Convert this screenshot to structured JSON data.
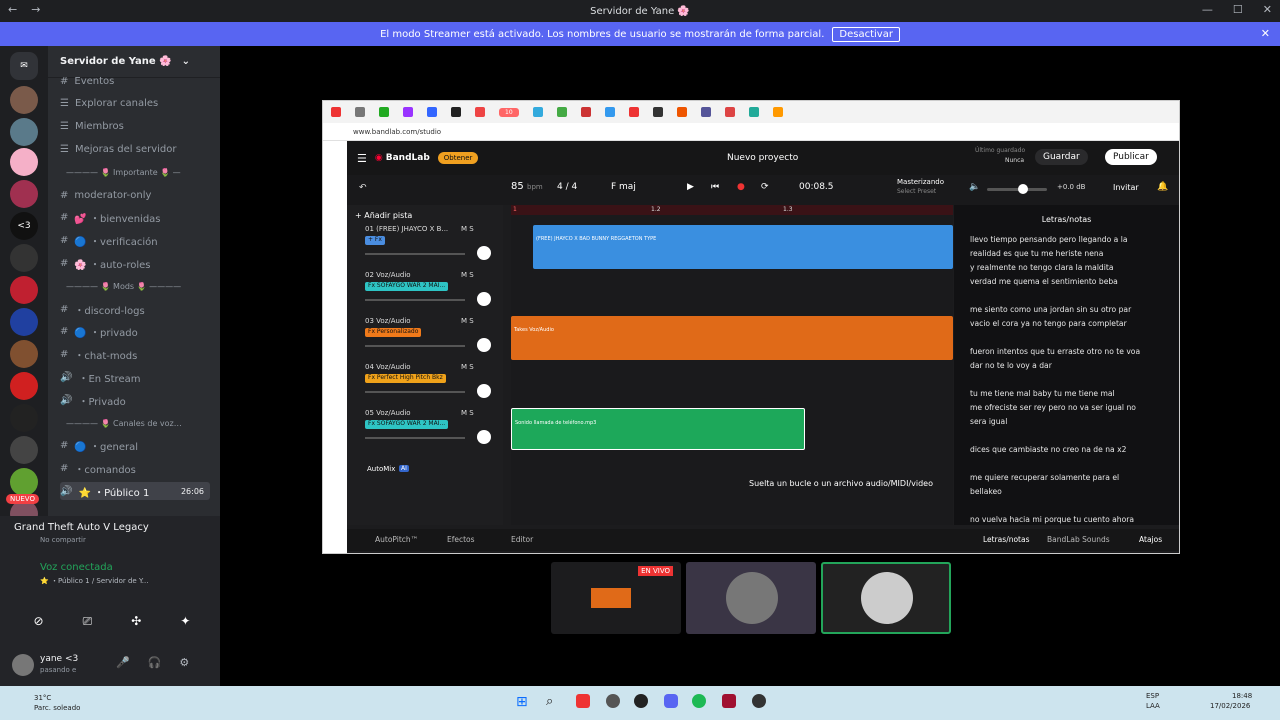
{
  "window": {
    "title": "Servidor de Yane 🌸",
    "nav_back": "←",
    "nav_fwd": "→",
    "wc_min": "—",
    "wc_max": "☐",
    "wc_close": "✕"
  },
  "streamer": {
    "text": "El modo Streamer está activado. Los nombres de usuario se mostrarán de forma parcial.",
    "button": "Desactivar",
    "close": "✕"
  },
  "server": {
    "name": "Servidor de Yane 🌸"
  },
  "channels": [
    {
      "label": "Eventos",
      "type": "text"
    },
    {
      "label": "Explorar canales",
      "type": "nav"
    },
    {
      "label": "Miembros",
      "type": "nav"
    },
    {
      "label": "Mejoras del servidor",
      "type": "nav"
    },
    {
      "label": "———— 🌷 Importante 🌷 —",
      "type": "cat"
    },
    {
      "label": "moderator-only",
      "type": "text"
    },
    {
      "label": "💕 ・bienvenidas",
      "type": "text"
    },
    {
      "label": "🔵 ・verificación",
      "type": "text"
    },
    {
      "label": "🌸 ・auto-roles",
      "type": "text"
    },
    {
      "label": "———— 🌷 Mods 🌷 ————",
      "type": "cat"
    },
    {
      "label": "・discord-logs",
      "type": "text"
    },
    {
      "label": "🔵 ・privado",
      "type": "text"
    },
    {
      "label": "・chat-mods",
      "type": "text"
    },
    {
      "label": "・En Stream",
      "type": "voice"
    },
    {
      "label": "・Privado",
      "type": "voice"
    },
    {
      "label": "———— 🌷 Canales de voz…",
      "type": "cat"
    },
    {
      "label": "🔵 ・general",
      "type": "text"
    },
    {
      "label": "・comandos",
      "type": "text"
    },
    {
      "label": "⭐ ・Público 1",
      "type": "voice_active",
      "time": "26:06"
    }
  ],
  "activity": {
    "game": "Grand Theft Auto V Legacy",
    "sub": "No compartir"
  },
  "voice": {
    "status": "Voz conectada",
    "channel": "⭐ ・Público 1 / Servidor de Y...",
    "new_badge": "NUEVO"
  },
  "user": {
    "name": "yane <3",
    "status": "pasando e"
  },
  "browser": {
    "url": "www.bandlab.com/studio",
    "badge": "10"
  },
  "bandlab": {
    "logo": "BandLab",
    "get_button": "Obtener",
    "project": "Nuevo proyecto",
    "last_saved": "Último guardado",
    "last_saved_value": "Nunca",
    "save": "Guardar",
    "publish": "Publicar",
    "bpm": "85",
    "bpm_unit": "bpm",
    "time_sig": "4 / 4",
    "key": "F maj",
    "time": "00:08.5",
    "mastering": "Masterizando",
    "mastering_sub": "Select Preset",
    "volume_db": "+0.0 dB",
    "invite": "Invitar",
    "add_track": "Añadir pista",
    "ruler": [
      "1",
      "1.2",
      "1.3"
    ],
    "tracks": [
      {
        "label": "01  (FREE) JHAYCO X B...",
        "fx": "+ Fx",
        "color": "#4a8de0"
      },
      {
        "label": "02  Voz/Audio",
        "fx": "Fx  SOFAYGO WAR 2 MAI...",
        "color": "#2ec4c4"
      },
      {
        "label": "03  Voz/Audio",
        "fx": "Fx  Personalizado",
        "color": "#f07a1a"
      },
      {
        "label": "04  Voz/Audio",
        "fx": "Fx  Perfect High Pitch Bkz",
        "color": "#f0a21a"
      },
      {
        "label": "05  Voz/Audio",
        "fx": "Fx  SOFAYGO WAR 2 MAI...",
        "color": "#2ec4c4"
      }
    ],
    "automix": "AutoMix",
    "ai": "AI",
    "clips": {
      "c1": "(FREE) JHAYCO X BAD BUNNY REGGAETON TYPE",
      "c2": "Takes   Voz/Audio",
      "c3": "Sonido llamada de teléfono.mp3"
    },
    "drop_text": "Suelta un bucle o un archivo audio/MIDI/video",
    "lyrics_title": "Letras/notas",
    "lyrics": [
      "llevo tiempo pensando pero llegando a la",
      "realidad es que tu me heriste nena",
      "y realmente no tengo clara  la maldita",
      "verdad me quema el sentimiento beba",
      "",
      "me siento como una jordan sin su otro par",
      "vacio  el cora ya no tengo para completar",
      "",
      "fueron intentos que tu erraste otro no te voa",
      "dar no te lo voy a dar",
      "",
      "tu me tiene mal baby tu me tiene mal",
      "me ofreciste ser rey pero no va ser igual no",
      "sera igual",
      "",
      "dices que cambiaste no creo na de na  x2",
      "",
      "me quiere recuperar solamente para el",
      "bellakeo",
      "",
      "no vuelva hacia mi porque tu cuento ahora"
    ],
    "bottom": {
      "autopitch": "AutoPitch™",
      "effects": "Efectos",
      "editor": "Editor",
      "lyrics": "Letras/notas",
      "sounds": "BandLab Sounds",
      "shortcuts": "Atajos"
    }
  },
  "stream": {
    "live": "EN VIVO"
  },
  "taskbar": {
    "temp": "31°C",
    "weather": "Parc. soleado",
    "lang": "ESP",
    "lang2": "LAA",
    "clock": "18:48",
    "date": "17/02/2026"
  }
}
